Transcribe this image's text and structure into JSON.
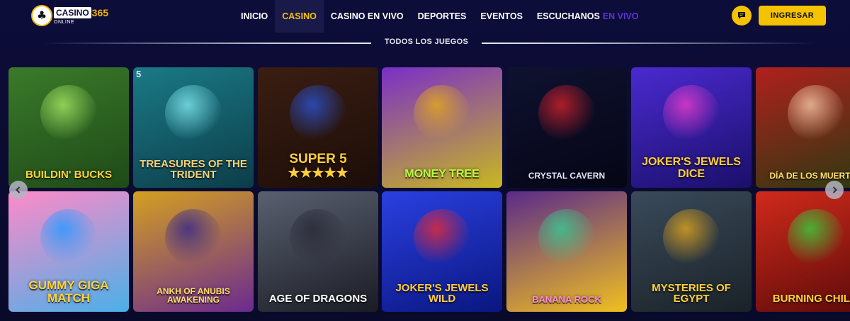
{
  "brand": {
    "logo_word1": "CASINO",
    "logo_word2": "365",
    "logo_sub": "ONLINE"
  },
  "nav": {
    "items": [
      {
        "label": "INICIO",
        "active": false
      },
      {
        "label": "CASINO",
        "active": true
      },
      {
        "label": "CASINO EN VIVO",
        "active": false
      },
      {
        "label": "DEPORTES",
        "active": false
      },
      {
        "label": "EVENTOS",
        "active": false
      }
    ],
    "listen_label": "ESCUCHANOS",
    "listen_live": "EN VIVO"
  },
  "actions": {
    "chat_icon": "chat-bubble-icon",
    "login_label": "INGRESAR"
  },
  "section": {
    "title": "TODOS LOS JUEGOS"
  },
  "colors": {
    "accent": "#f5c200",
    "background": "#0b0b30",
    "live": "#5a34d6"
  },
  "games": [
    {
      "title": "BUILDIN' BUCKS",
      "bg": "#3a7a2a",
      "bg2": "#1f4a18",
      "color": "#ffd23a",
      "size": 15,
      "deco": "#a0e060"
    },
    {
      "title": "TREASURES OF THE TRIDENT",
      "bg": "#1a7a86",
      "bg2": "#0c3d49",
      "color": "#f2d27a",
      "size": 15,
      "deco": "#7ae0e8",
      "badge": "5"
    },
    {
      "title": "SUPER 5 ★★★★★",
      "bg": "#3a1e12",
      "bg2": "#1c0d08",
      "color": "#ffcf3a",
      "size": 19,
      "deco": "#2a4fc8"
    },
    {
      "title": "MONEY TREE",
      "bg": "#7a2ec8",
      "bg2": "#c8b820",
      "color": "#b6ff3a",
      "size": 16,
      "deco": "#e0a820"
    },
    {
      "title": "CRYSTAL CAVERN",
      "bg": "#0f1230",
      "bg2": "#050515",
      "color": "#e0e6ff",
      "size": 12,
      "deco": "#c8202a"
    },
    {
      "title": "JOKER'S JEWELS DICE",
      "bg": "#4a2ad0",
      "bg2": "#1a0f6a",
      "color": "#ffcf3a",
      "size": 16,
      "deco": "#e03ac8"
    },
    {
      "title": "DÍA DE LOS MUERTOS",
      "bg": "#b0201e",
      "bg2": "#2a3a10",
      "color": "#ffe070",
      "size": 12,
      "deco": "#f0c0a0"
    },
    {
      "title": "GUMMY GIGA MATCH",
      "bg": "#ff8ac8",
      "bg2": "#4ab0e8",
      "color": "#ffd23a",
      "size": 17,
      "deco": "#2a9aff"
    },
    {
      "title": "ANKH OF ANUBIS AWAKENING",
      "bg": "#d4a020",
      "bg2": "#6a2a90",
      "color": "#ffe070",
      "size": 12,
      "deco": "#3a2a8a"
    },
    {
      "title": "AGE OF DRAGONS",
      "bg": "#5a6070",
      "bg2": "#1a1c24",
      "color": "#ffffff",
      "size": 15,
      "deco": "#2a2c38"
    },
    {
      "title": "JOKER'S JEWELS WILD",
      "bg": "#2a40e0",
      "bg2": "#0a1680",
      "color": "#ffcf3a",
      "size": 15,
      "deco": "#e02a3a"
    },
    {
      "title": "BANANA ROCK",
      "bg": "#5a2a8a",
      "bg2": "#f0c020",
      "color": "#ff8ad8",
      "size": 13,
      "deco": "#3ac890"
    },
    {
      "title": "MYSTERIES OF EGYPT",
      "bg": "#3a4a5a",
      "bg2": "#1a2228",
      "color": "#ffd23a",
      "size": 15,
      "deco": "#d8a020"
    },
    {
      "title": "BURNING CHILLI",
      "bg": "#d02a1a",
      "bg2": "#5a0a0a",
      "color": "#ffd23a",
      "size": 15,
      "deco": "#3ac83a"
    }
  ],
  "carousel": {
    "prev_icon": "chevron-left-icon",
    "next_icon": "chevron-right-icon"
  }
}
